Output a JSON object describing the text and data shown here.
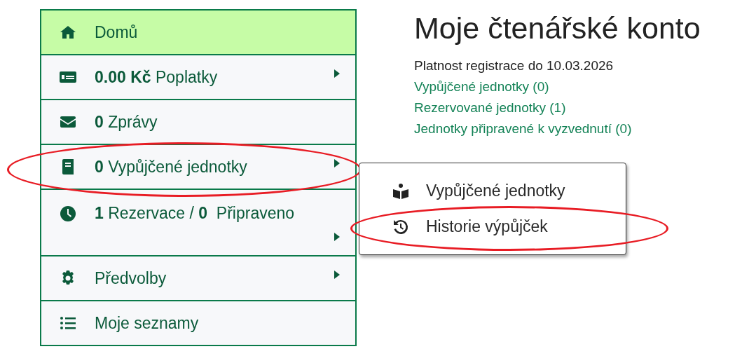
{
  "sidebar": {
    "items": [
      {
        "kind": "home",
        "label": "Domů",
        "submenu": false,
        "selected": true,
        "highlighted": false
      },
      {
        "kind": "money",
        "label": "**0.00 Kč** Poplatky",
        "submenu": true,
        "selected": false,
        "highlighted": false
      },
      {
        "kind": "envelope",
        "label": "**0** Zprávy",
        "submenu": false,
        "selected": false,
        "highlighted": false
      },
      {
        "kind": "book",
        "label": "**0** Vypůjčené jednotky",
        "submenu": true,
        "selected": false,
        "highlighted": true
      },
      {
        "kind": "clock",
        "label": "**1** Rezervace / **0**  Připraveno",
        "submenu": true,
        "selected": false,
        "highlighted": false
      },
      {
        "kind": "gear",
        "label": "Předvolby",
        "submenu": true,
        "selected": false,
        "highlighted": false
      },
      {
        "kind": "list",
        "label": "Moje seznamy",
        "submenu": false,
        "selected": false,
        "highlighted": false
      }
    ]
  },
  "main": {
    "title": "Moje čtenářské konto",
    "registration": "Platnost registrace do 10.03.2026",
    "links": [
      "Vypůjčené jednotky (0)",
      "Rezervované jednotky (1)",
      "Jednotky připravené k vyzvednutí (0)"
    ]
  },
  "submenu": {
    "items": [
      {
        "kind": "reader",
        "label": "Vypůjčené jednotky",
        "highlighted": false
      },
      {
        "kind": "history",
        "label": "Historie výpůjček",
        "highlighted": true
      }
    ]
  }
}
